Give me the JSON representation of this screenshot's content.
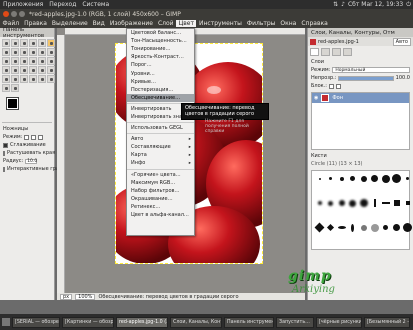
{
  "system_panel": {
    "menus": [
      "Приложения",
      "Переход",
      "Система"
    ],
    "clock": "Сбт Mar 12, 19:33",
    "icons": [
      "network-icon",
      "volume-icon",
      "power-icon"
    ]
  },
  "window": {
    "title": "*red-apples.jpg-1.0 (RGB, 1 слой) 450x600 – GIMP"
  },
  "menubar": {
    "items": [
      "Файл",
      "Правка",
      "Выделение",
      "Вид",
      "Изображение",
      "Слой",
      "Цвет",
      "Инструменты",
      "Фильтры",
      "Окна",
      "Справка"
    ],
    "active": "Цвет"
  },
  "toolbox": {
    "title": "Панель инструментов",
    "options_title": "Ножницы",
    "mode_label": "Режим:",
    "checkbox1": "Сглаживание",
    "checkbox2": "Растушевать края",
    "radius_label": "Радиус:",
    "radius_value": "10.0",
    "checkbox3": "Интерактивные границы"
  },
  "color_menu": {
    "items": [
      "Цветовой баланс…",
      "Тон-Насыщенность…",
      "Тонирование…",
      "Яркость-Контраст…",
      "Порог…",
      "Уровни…",
      "Кривые…",
      "Постеризация…",
      "Обесцвечивание…",
      "Инвертировать",
      "Инвертировать значение",
      "Использовать GEGL",
      "Авто",
      "Составляющие",
      "Карта",
      "Инфо",
      "«Горячие» цвета…",
      "Максимум RGB…",
      "Набор фильтров…",
      "Окрашивание…",
      "Ретинекс…",
      "Цвет в альфа-канал…"
    ],
    "highlighted": "Обесцвечивание…"
  },
  "tooltip": {
    "text": "Обесцвечивание: перевод цветов в градации серого",
    "hint": "Нажмите F1 для получения полной справки"
  },
  "statusbar": {
    "units": "px",
    "zoom": "100%",
    "message": "Обесцвечивание: перевод цветов в градации серого"
  },
  "dock": {
    "title": "Слои, Каналы, Контуры, Отм",
    "image_label": "red-apples.jpg-1",
    "auto_label": "Авто",
    "layers_label": "Слои",
    "mode_label": "Режим:",
    "mode_value": "Нормальный",
    "opacity_label": "Непрозр.:",
    "opacity_value": "100.0",
    "lock_label": "Блок.:",
    "layer_name": "Фон",
    "brushes_title": "Кисти",
    "brush_info": "Circle (11) (13 × 13)"
  },
  "logo": {
    "text": "gimp",
    "sub": "Arkiying"
  },
  "taskbar": {
    "items": [
      "[SERIAL — обозрева…",
      "[Картинки — обозре…",
      "red-apples.jpg-1.0 (…",
      "Слои, Каналы, Конту…",
      "Панель инструментов",
      "Запустить…",
      "[чёрные рисунки…",
      "[Безымянный 2 - Kat…"
    ]
  }
}
